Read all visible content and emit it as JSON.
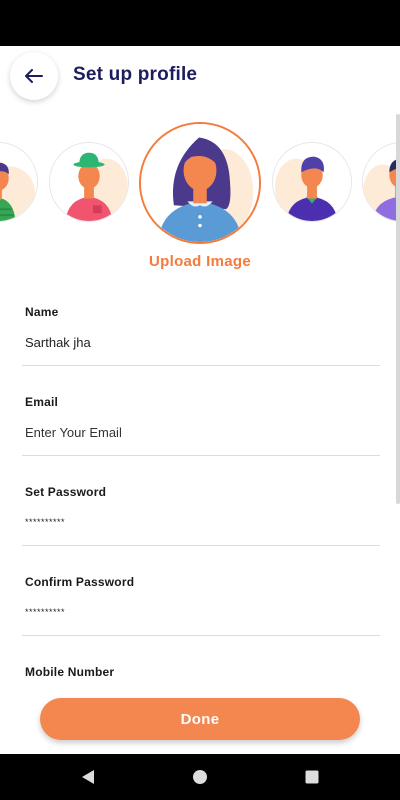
{
  "header": {
    "back_icon": "arrow-left-icon",
    "title": "Set up profile"
  },
  "avatars": {
    "selected_index": 2,
    "items": [
      {
        "name": "avatar-1",
        "shirt": "#34a853"
      },
      {
        "name": "avatar-2",
        "shirt": "#f0546e",
        "hat": "#2bb673"
      },
      {
        "name": "avatar-3",
        "shirt": "#5b9bd5",
        "hair": "#4b3a8c"
      },
      {
        "name": "avatar-4",
        "shirt": "#4b2fb0",
        "hair": "#5140a8"
      },
      {
        "name": "avatar-5",
        "shirt": "#8e6ee0"
      }
    ],
    "upload_label": "Upload Image"
  },
  "form": {
    "name": {
      "label": "Name",
      "value": "Sarthak jha"
    },
    "email": {
      "label": "Email",
      "placeholder": "Enter Your Email",
      "value": ""
    },
    "password": {
      "label": "Set Password",
      "value": "**********"
    },
    "confirm_password": {
      "label": "Confirm Password",
      "value": "**********"
    },
    "mobile": {
      "label": "Mobile Number"
    }
  },
  "done_label": "Done",
  "nav": {
    "back_icon": "triangle-back-icon",
    "home_icon": "circle-home-icon",
    "recents_icon": "square-recents-icon"
  },
  "colors": {
    "accent": "#f47b3c",
    "button": "#f4874f",
    "title": "#1c1c5e",
    "avatar_bg": "#fdebd8"
  }
}
